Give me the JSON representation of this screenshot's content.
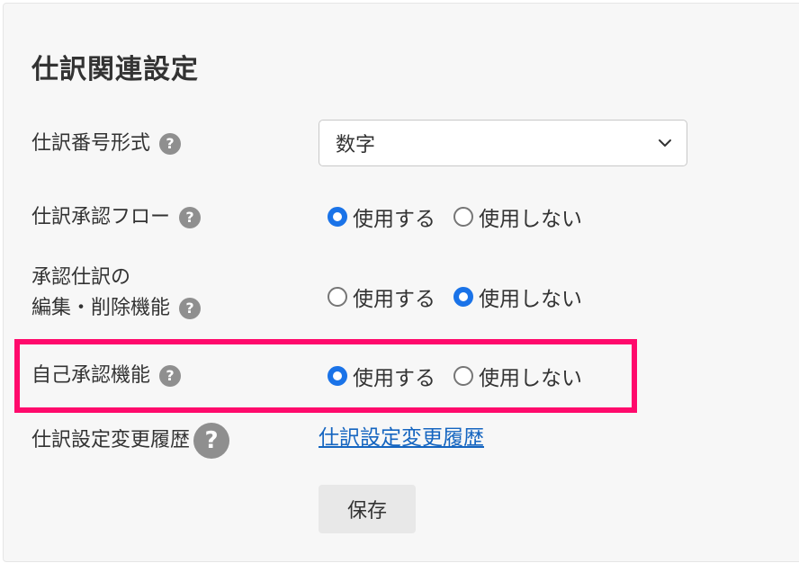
{
  "title": "仕訳関連設定",
  "rows": [
    {
      "label": "仕訳番号形式",
      "help": "?"
    },
    {
      "label": "仕訳承認フロー",
      "help": "?"
    },
    {
      "label_line1": "承認仕訳の",
      "label_line2": "編集・削除機能",
      "help": "?"
    },
    {
      "label": "自己承認機能",
      "help": "?"
    },
    {
      "label": "仕訳設定変更履歴",
      "help": "?"
    }
  ],
  "number_format_select": {
    "value": "数字"
  },
  "options": {
    "use": "使用する",
    "not_use": "使用しない"
  },
  "selections": {
    "approval_flow": "use",
    "edit_delete_approved": "not_use",
    "self_approval": "use"
  },
  "history_link": "仕訳設定変更履歴",
  "save_button": "保存",
  "colors": {
    "accent": "#1a73e8",
    "highlight": "#ff0a6c",
    "link": "#1565c0"
  }
}
